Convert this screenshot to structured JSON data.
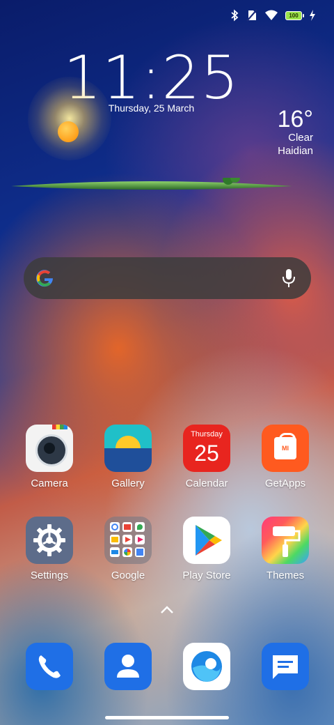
{
  "status_bar": {
    "bluetooth": "bluetooth-icon",
    "sim": "no-sim-icon",
    "wifi": "wifi-icon",
    "battery_level": "100",
    "charging": "lightning-icon"
  },
  "clock": {
    "time": "11:25",
    "date": "Thursday, 25 March"
  },
  "weather": {
    "temperature": "16°",
    "condition": "Clear",
    "location": "Haidian"
  },
  "search": {
    "logo": "google-g-icon",
    "mic": "microphone-icon"
  },
  "apps": [
    {
      "label": "Camera"
    },
    {
      "label": "Gallery"
    },
    {
      "label": "Calendar",
      "weekday": "Thursday",
      "day": "25"
    },
    {
      "label": "GetApps",
      "badge": "MI"
    },
    {
      "label": "Settings"
    },
    {
      "label": "Google"
    },
    {
      "label": "Play Store"
    },
    {
      "label": "Themes"
    }
  ],
  "drawer": {
    "icon": "chevron-up-icon"
  },
  "dock": [
    "phone-icon",
    "contacts-icon",
    "browser-icon",
    "messages-icon"
  ],
  "colors": {
    "accent_blue": "#1f6fe6",
    "calendar_red": "#e8251f",
    "getapps_orange": "#ff5a1f"
  }
}
